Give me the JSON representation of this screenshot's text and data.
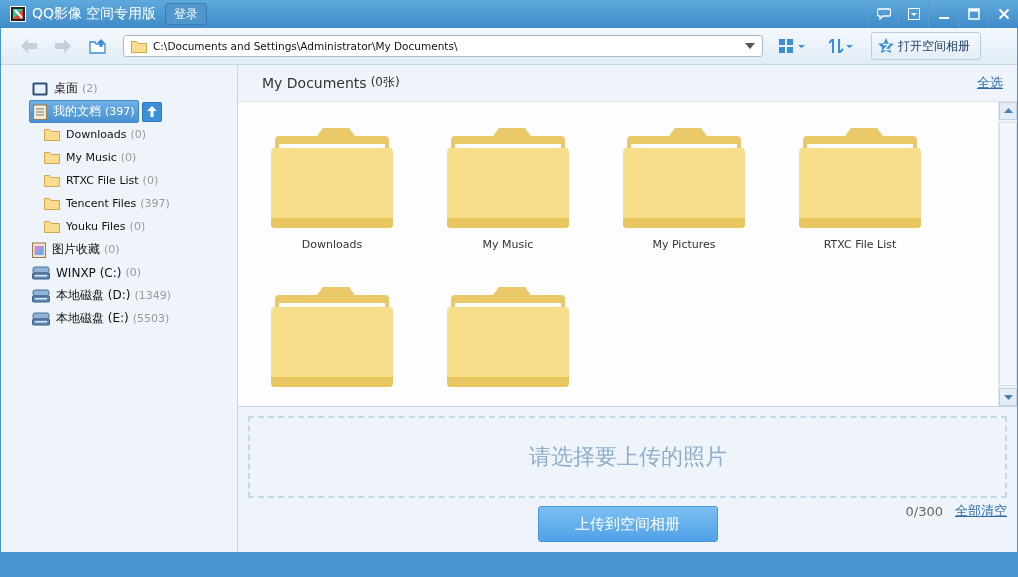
{
  "window": {
    "title": "QQ影像 空间专用版",
    "login_button": "登录"
  },
  "toolbar": {
    "path": "C:\\Documents and Settings\\Administrator\\My Documents\\",
    "open_album_button": "打开空间相册"
  },
  "sidebar": {
    "items": [
      {
        "kind": "desktop",
        "label": "桌面",
        "count": "(2)",
        "selected": false
      },
      {
        "kind": "documents",
        "label": "我的文档",
        "count": "(397)",
        "selected": true,
        "children": [
          {
            "kind": "folder",
            "label": "Downloads",
            "count": "(0)",
            "selected": false
          },
          {
            "kind": "folder",
            "label": "My Music",
            "count": "(0)",
            "selected": false
          },
          {
            "kind": "folder",
            "label": "RTXC File List",
            "count": "(0)",
            "selected": false
          },
          {
            "kind": "folder",
            "label": "Tencent Files",
            "count": "(397)",
            "selected": false
          },
          {
            "kind": "folder",
            "label": "Youku Files",
            "count": "(0)",
            "selected": false
          }
        ]
      },
      {
        "kind": "pictures",
        "label": "图片收藏",
        "count": "(0)",
        "selected": false
      },
      {
        "kind": "drive",
        "label": "WINXP (C:)",
        "count": "(0)",
        "selected": false
      },
      {
        "kind": "drive",
        "label": "本地磁盘 (D:)",
        "count": "(1349)",
        "selected": false
      },
      {
        "kind": "drive",
        "label": "本地磁盘 (E:)",
        "count": "(5503)",
        "selected": false
      }
    ]
  },
  "content": {
    "title": "My Documents",
    "count": "(0张)",
    "select_all": "全选",
    "folders": [
      {
        "kind": "folder",
        "label": "Downloads"
      },
      {
        "kind": "folder",
        "label": "My Music"
      },
      {
        "kind": "folder",
        "label": "My Pictures"
      },
      {
        "kind": "folder",
        "label": "RTXC File List"
      },
      {
        "kind": "folder"
      },
      {
        "kind": "folder"
      }
    ]
  },
  "upload": {
    "placeholder": "请选择要上传的照片",
    "counter": "0/300",
    "clear_all": "全部清空",
    "upload_button": "上传到空间相册"
  }
}
